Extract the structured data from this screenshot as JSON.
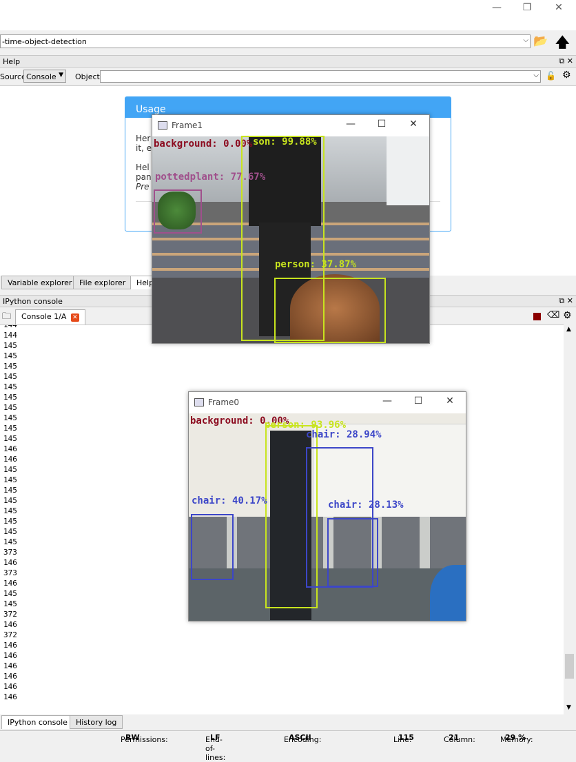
{
  "path_bar": {
    "value": "-time-object-detection"
  },
  "help_pane": {
    "title": "Help",
    "source_label": "Source",
    "source_value": "Console",
    "object_label": "Object",
    "usage_title": "Usage",
    "usage_text1_a": "Her",
    "usage_text1_b": "it, e",
    "usage_text2_a": "Hel",
    "usage_text2_b": "pan",
    "usage_text2_c": "Pre"
  },
  "middle_tabs": [
    "Variable explorer",
    "File explorer",
    "Help"
  ],
  "ipython": {
    "title": "IPython console",
    "console_tab": "Console 1/A",
    "lines": [
      "144",
      "144",
      "145",
      "145",
      "145",
      "145",
      "145",
      "145",
      "145",
      "145",
      "145",
      "145",
      "146",
      "146",
      "145",
      "145",
      "145",
      "145",
      "145",
      "145",
      "145",
      "145",
      "373",
      "146",
      "373",
      "146",
      "145",
      "145",
      "372",
      "146",
      "372",
      "146",
      "146",
      "146",
      "146",
      "146",
      "146"
    ]
  },
  "bottom_tabs": [
    "IPython console",
    "History log"
  ],
  "status": {
    "permissions_label": "Permissions:",
    "permissions": "RW",
    "eol_label": "End-of-lines:",
    "eol": "LF",
    "encoding_label": "Encoding:",
    "encoding": "ASCII",
    "line_label": "Line:",
    "line": "115",
    "column_label": "Column:",
    "column": "21",
    "memory_label": "Memory:",
    "memory": "29 %"
  },
  "frame1": {
    "title": "Frame1",
    "detections": [
      {
        "label": "background: 0.00%",
        "color": "#8b0a1e"
      },
      {
        "label": "son: 99.88%",
        "color": "#c8e41e"
      },
      {
        "label": "pottedplant: 77.67%",
        "color": "#a0508c"
      },
      {
        "label": "person: 37.87%",
        "color": "#c8e41e"
      }
    ]
  },
  "frame0": {
    "title": "Frame0",
    "detections": [
      {
        "label": "background: 0.00%",
        "color": "#8b0a1e"
      },
      {
        "label": "person: 93.96%",
        "color": "#c8e41e"
      },
      {
        "label": "chair: 28.94%",
        "color": "#3c46c8"
      },
      {
        "label": "chair: 40.17%",
        "color": "#3c46c8"
      },
      {
        "label": "chair: 28.13%",
        "color": "#3c46c8"
      }
    ]
  },
  "colors": {
    "accent": "#42a5f5",
    "close_red": "#e64a19",
    "stop_red": "#8b0000"
  }
}
